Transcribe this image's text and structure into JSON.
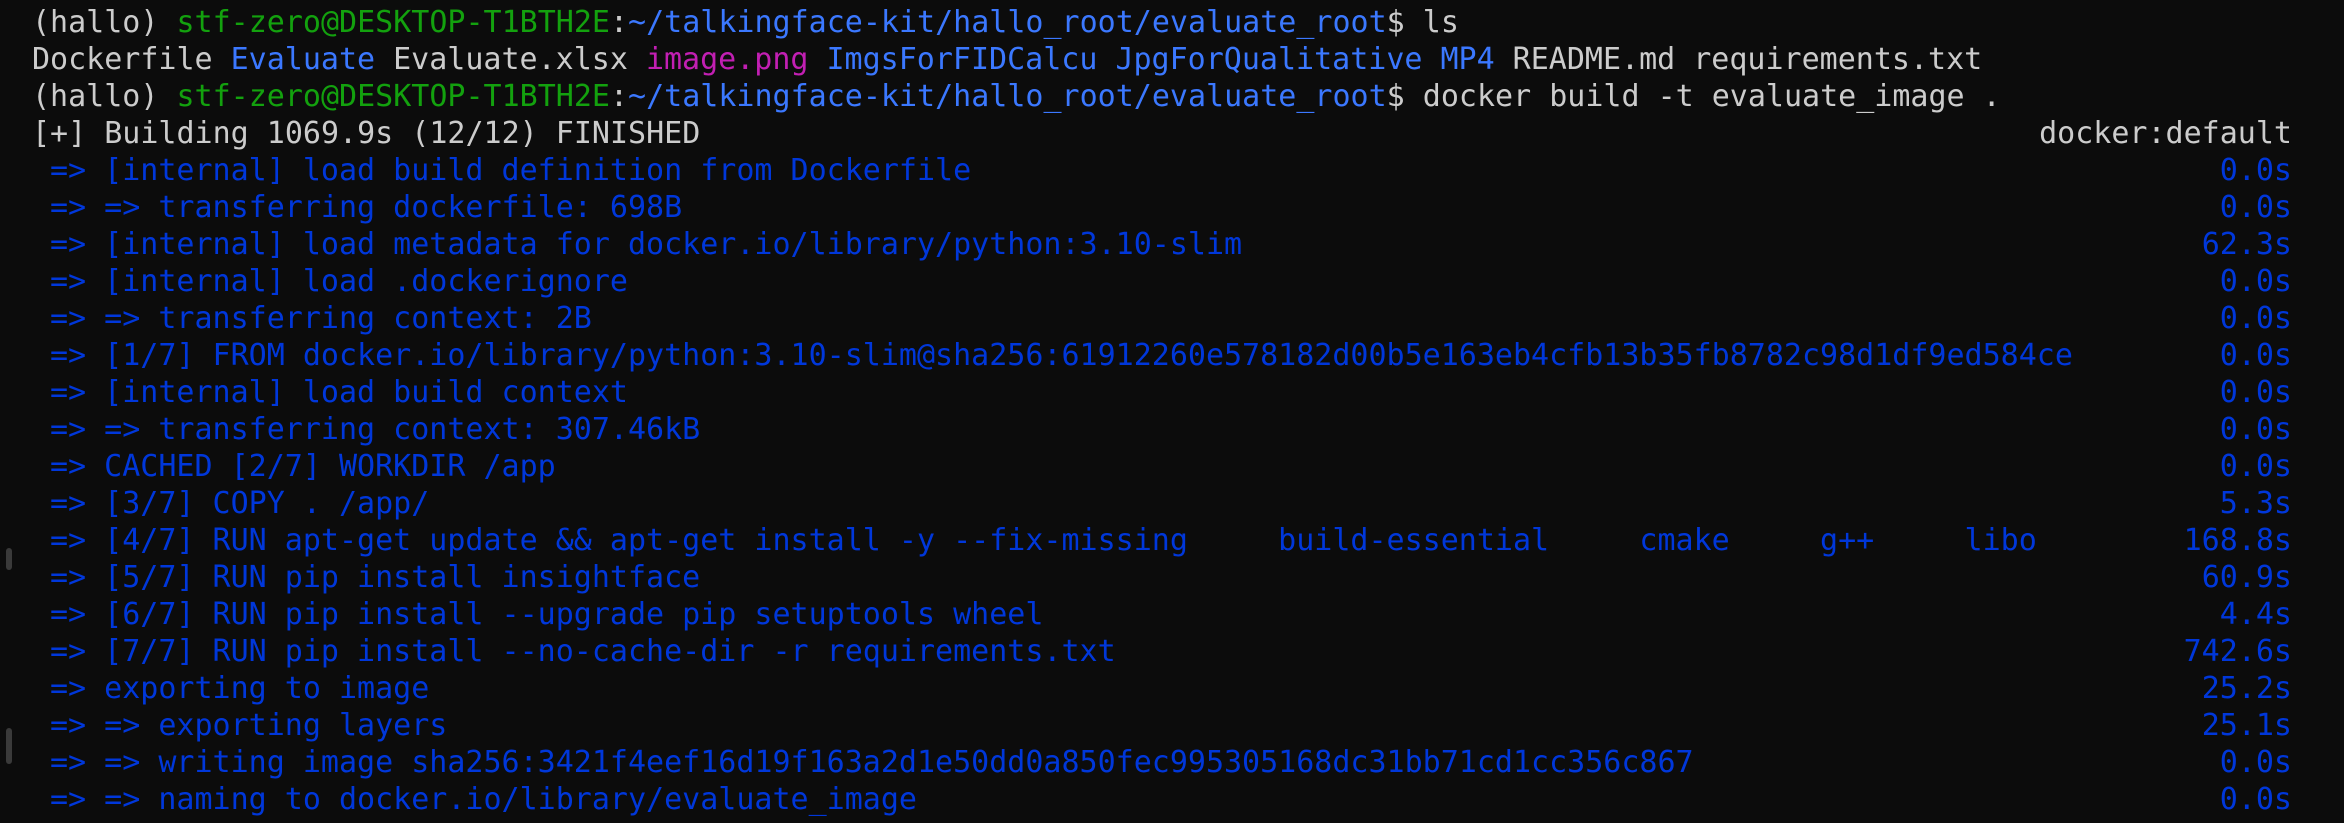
{
  "terminal": {
    "colors": {
      "background": "#0c0c0c",
      "text": "#cccccc",
      "user_host": "#13a10e",
      "path": "#3b78ff",
      "directory": "#3b78ff",
      "image_file": "#c21fb3",
      "build_step": "#0037da"
    },
    "prompt1": {
      "env": "(hallo) ",
      "user_host": "stf-zero@DESKTOP-T1BTH2E",
      "colon": ":",
      "path": "~/talkingface-kit/hallo_root/evaluate_root",
      "dollar": "$ ",
      "command": "ls"
    },
    "ls_output": [
      {
        "name": "Dockerfile",
        "kind": "file"
      },
      {
        "name": "Evaluate",
        "kind": "dir"
      },
      {
        "name": "Evaluate.xlsx",
        "kind": "file"
      },
      {
        "name": "image.png",
        "kind": "img"
      },
      {
        "name": "ImgsForFIDCalcu",
        "kind": "dir"
      },
      {
        "name": "JpgForQualitative",
        "kind": "dir"
      },
      {
        "name": "MP4",
        "kind": "dir"
      },
      {
        "name": "README.md",
        "kind": "file"
      },
      {
        "name": "requirements.txt",
        "kind": "file"
      }
    ],
    "prompt2": {
      "env": "(hallo) ",
      "user_host": "stf-zero@DESKTOP-T1BTH2E",
      "colon": ":",
      "path": "~/talkingface-kit/hallo_root/evaluate_root",
      "dollar": "$ ",
      "command": "docker build -t evaluate_image ."
    },
    "build_header": {
      "text": "[+] Building 1069.9s (12/12) FINISHED",
      "context": "docker:default"
    },
    "build_steps": [
      {
        "text": "=> [internal] load build definition from Dockerfile",
        "time": "0.0s"
      },
      {
        "text": "=> => transferring dockerfile: 698B",
        "time": "0.0s"
      },
      {
        "text": "=> [internal] load metadata for docker.io/library/python:3.10-slim",
        "time": "62.3s"
      },
      {
        "text": "=> [internal] load .dockerignore",
        "time": "0.0s"
      },
      {
        "text": "=> => transferring context: 2B",
        "time": "0.0s"
      },
      {
        "text": "=> [1/7] FROM docker.io/library/python:3.10-slim@sha256:61912260e578182d00b5e163eb4cfb13b35fb8782c98d1df9ed584ce",
        "time": "0.0s"
      },
      {
        "text": "=> [internal] load build context",
        "time": "0.0s"
      },
      {
        "text": "=> => transferring context: 307.46kB",
        "time": "0.0s"
      },
      {
        "text": "=> CACHED [2/7] WORKDIR /app",
        "time": "0.0s"
      },
      {
        "text": "=> [3/7] COPY . /app/",
        "time": "5.3s"
      },
      {
        "text": "=> [4/7] RUN apt-get update && apt-get install -y --fix-missing     build-essential     cmake     g++     libo",
        "time": "168.8s"
      },
      {
        "text": "=> [5/7] RUN pip install insightface",
        "time": "60.9s"
      },
      {
        "text": "=> [6/7] RUN pip install --upgrade pip setuptools wheel",
        "time": "4.4s"
      },
      {
        "text": "=> [7/7] RUN pip install --no-cache-dir -r requirements.txt",
        "time": "742.6s"
      },
      {
        "text": "=> exporting to image",
        "time": "25.2s"
      },
      {
        "text": "=> => exporting layers",
        "time": "25.1s"
      },
      {
        "text": "=> => writing image sha256:3421f4eef16d19f163a2d1e50dd0a850fec995305168dc31bb71cd1cc356c867",
        "time": "0.0s"
      },
      {
        "text": "=> => naming to docker.io/library/evaluate_image",
        "time": "0.0s"
      }
    ]
  }
}
